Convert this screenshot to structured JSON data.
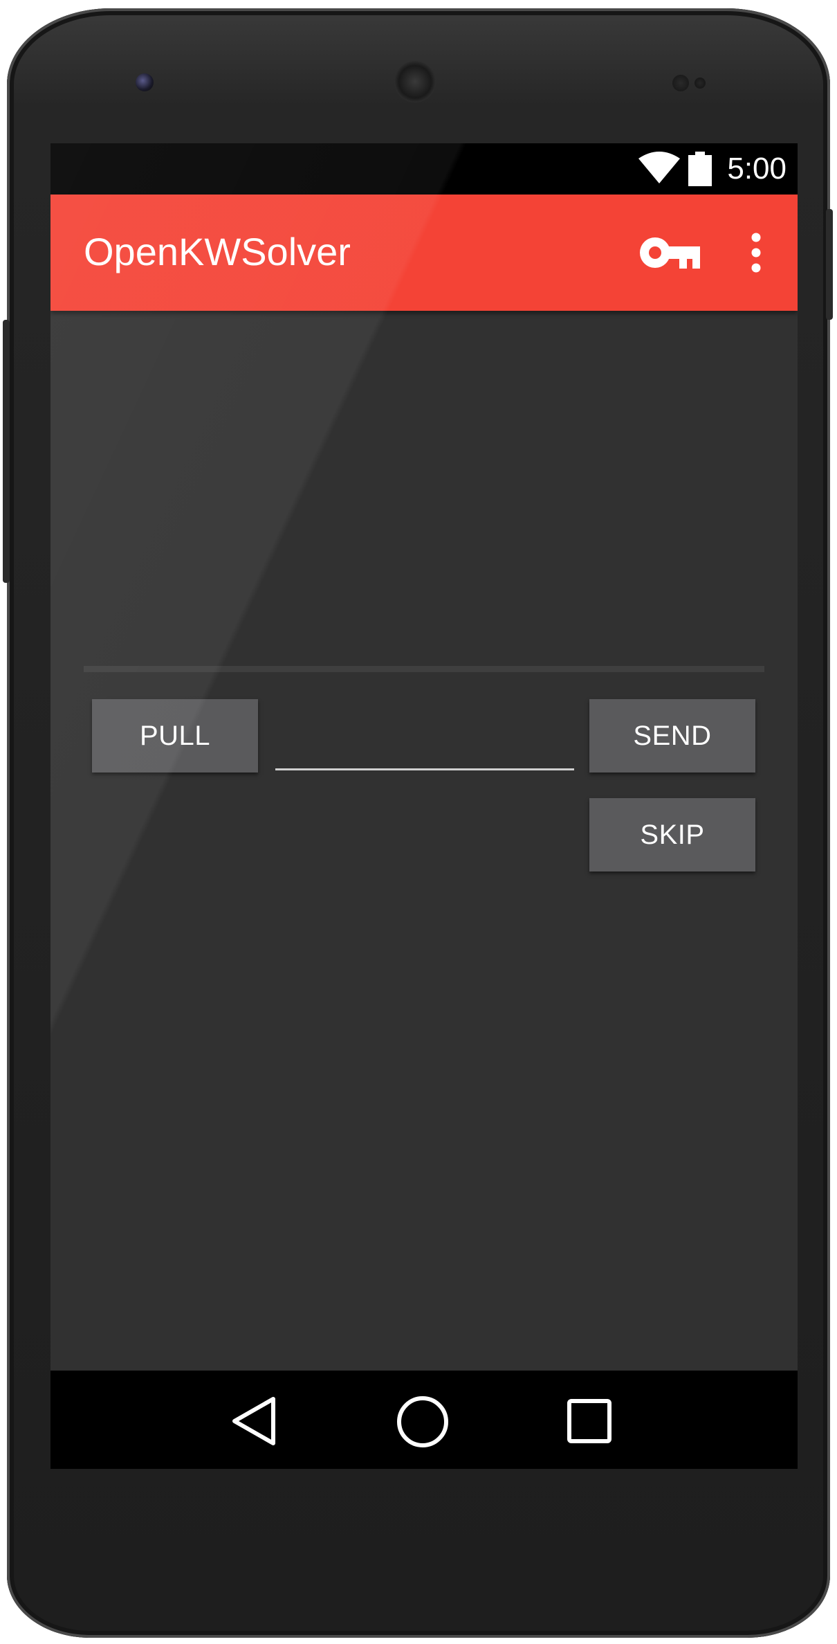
{
  "status_bar": {
    "time": "5:00",
    "icons": [
      "wifi-icon",
      "battery-icon"
    ]
  },
  "app_bar": {
    "title": "OpenKWSolver",
    "actions": [
      "key-icon",
      "more-vert-icon"
    ],
    "color": "#f44336"
  },
  "main": {
    "pull_label": "PULL",
    "send_label": "SEND",
    "skip_label": "SKIP",
    "answer_input": {
      "value": "",
      "placeholder": ""
    }
  },
  "nav_bar": {
    "icons": [
      "back-icon",
      "home-icon",
      "recents-icon"
    ]
  }
}
